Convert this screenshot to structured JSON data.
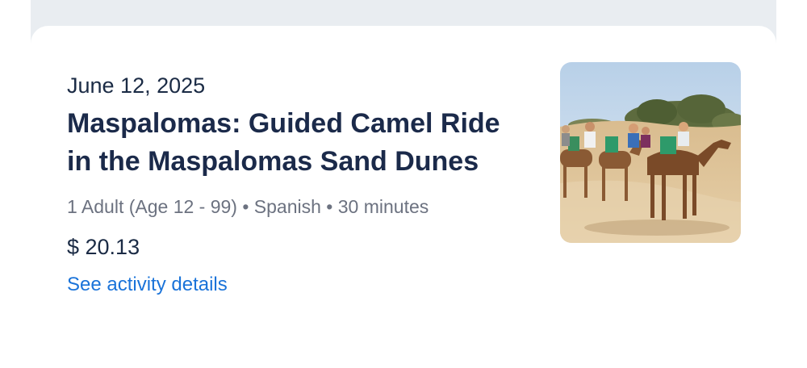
{
  "activity": {
    "date": "June 12, 2025",
    "title": "Maspalomas: Guided Camel Ride in the Maspalomas Sand Dunes",
    "meta": "1 Adult (Age 12 - 99) • Spanish • 30 minutes",
    "price": "$ 20.13",
    "details_link": "See activity details"
  },
  "colors": {
    "page_background": "#e9edf1",
    "title": "#1b2a4a",
    "meta": "#6c7280",
    "link": "#1a73d9"
  }
}
